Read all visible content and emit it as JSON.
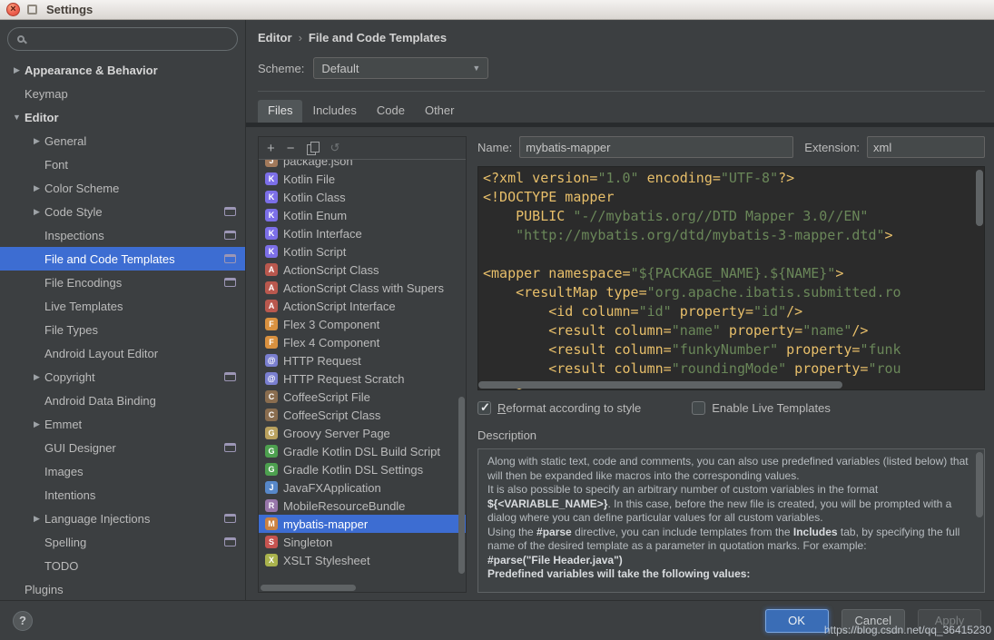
{
  "window": {
    "title": "Settings"
  },
  "colors": {
    "selection_blue": "#3d6dd2",
    "editor_background": "#2b2b2b",
    "xml_tag": "#e8bf6a",
    "xml_string": "#6a8759",
    "panel_background": "#3c3f41"
  },
  "sidebar": {
    "search_placeholder": "",
    "items": [
      {
        "label": "Appearance & Behavior",
        "indent": 0,
        "arrow": "right",
        "bold": true
      },
      {
        "label": "Keymap",
        "indent": 0
      },
      {
        "label": "Editor",
        "indent": 0,
        "arrow": "down",
        "bold": true
      },
      {
        "label": "General",
        "indent": 1,
        "arrow": "right"
      },
      {
        "label": "Font",
        "indent": 1
      },
      {
        "label": "Color Scheme",
        "indent": 1,
        "arrow": "right"
      },
      {
        "label": "Code Style",
        "indent": 1,
        "arrow": "right",
        "badge": true
      },
      {
        "label": "Inspections",
        "indent": 1,
        "badge": true
      },
      {
        "label": "File and Code Templates",
        "indent": 1,
        "badge": true,
        "selected": true
      },
      {
        "label": "File Encodings",
        "indent": 1,
        "badge": true
      },
      {
        "label": "Live Templates",
        "indent": 1
      },
      {
        "label": "File Types",
        "indent": 1
      },
      {
        "label": "Android Layout Editor",
        "indent": 1
      },
      {
        "label": "Copyright",
        "indent": 1,
        "arrow": "right",
        "badge": true
      },
      {
        "label": "Android Data Binding",
        "indent": 1
      },
      {
        "label": "Emmet",
        "indent": 1,
        "arrow": "right"
      },
      {
        "label": "GUI Designer",
        "indent": 1,
        "badge": true
      },
      {
        "label": "Images",
        "indent": 1
      },
      {
        "label": "Intentions",
        "indent": 1
      },
      {
        "label": "Language Injections",
        "indent": 1,
        "arrow": "right",
        "badge": true
      },
      {
        "label": "Spelling",
        "indent": 1,
        "badge": true
      },
      {
        "label": "TODO",
        "indent": 1
      },
      {
        "label": "Plugins",
        "indent": 0
      }
    ]
  },
  "header": {
    "breadcrumb": {
      "first": "Editor",
      "separator": "›",
      "second": "File and Code Templates"
    },
    "scheme_label": "Scheme:",
    "scheme_value": "Default"
  },
  "tabs": [
    {
      "label": "Files",
      "active": true
    },
    {
      "label": "Includes"
    },
    {
      "label": "Code"
    },
    {
      "label": "Other"
    }
  ],
  "templates": {
    "items": [
      {
        "label": "package.json",
        "icon": "json"
      },
      {
        "label": "Kotlin File",
        "icon": "kotlin"
      },
      {
        "label": "Kotlin Class",
        "icon": "kotlin"
      },
      {
        "label": "Kotlin Enum",
        "icon": "kotlin"
      },
      {
        "label": "Kotlin Interface",
        "icon": "kotlin"
      },
      {
        "label": "Kotlin Script",
        "icon": "kotlin"
      },
      {
        "label": "ActionScript Class",
        "icon": "actionscript"
      },
      {
        "label": "ActionScript Class with Supers",
        "icon": "actionscript"
      },
      {
        "label": "ActionScript Interface",
        "icon": "actionscript"
      },
      {
        "label": "Flex 3 Component",
        "icon": "flex"
      },
      {
        "label": "Flex 4 Component",
        "icon": "flex"
      },
      {
        "label": "HTTP Request",
        "icon": "http"
      },
      {
        "label": "HTTP Request Scratch",
        "icon": "http"
      },
      {
        "label": "CoffeeScript File",
        "icon": "coffeescript"
      },
      {
        "label": "CoffeeScript Class",
        "icon": "coffeescript"
      },
      {
        "label": "Groovy Server Page",
        "icon": "groovy"
      },
      {
        "label": "Gradle Kotlin DSL Build Script",
        "icon": "gradle"
      },
      {
        "label": "Gradle Kotlin DSL Settings",
        "icon": "gradle"
      },
      {
        "label": "JavaFXApplication",
        "icon": "javafx"
      },
      {
        "label": "MobileResourceBundle",
        "icon": "resource"
      },
      {
        "label": "mybatis-mapper",
        "icon": "file",
        "selected": true
      },
      {
        "label": "Singleton",
        "icon": "singleton"
      },
      {
        "label": "XSLT Stylesheet",
        "icon": "xslt"
      }
    ],
    "icon_styles": {
      "json": {
        "letter": "J",
        "bg": "#a1795b"
      },
      "kotlin": {
        "letter": "K",
        "bg": "#7c6fe8"
      },
      "actionscript": {
        "letter": "A",
        "bg": "#b9584e"
      },
      "flex": {
        "letter": "F",
        "bg": "#d9913f"
      },
      "http": {
        "letter": "@",
        "bg": "#7a7fd0"
      },
      "coffeescript": {
        "letter": "C",
        "bg": "#8a6d4f"
      },
      "groovy": {
        "letter": "G",
        "bg": "#b9a15e"
      },
      "gradle": {
        "letter": "G",
        "bg": "#4da04f"
      },
      "javafx": {
        "letter": "J",
        "bg": "#5788c9"
      },
      "resource": {
        "letter": "R",
        "bg": "#9876aa"
      },
      "file": {
        "letter": "M",
        "bg": "#cc8242"
      },
      "singleton": {
        "letter": "S",
        "bg": "#c75450"
      },
      "xslt": {
        "letter": "X",
        "bg": "#aab34d"
      }
    }
  },
  "detail": {
    "name_label": "Name:",
    "name_value": "mybatis-mapper",
    "extension_label": "Extension:",
    "extension_value": "xml",
    "reformat_label": "Reformat according to style",
    "reformat_checked": true,
    "live_templates_label": "Enable Live Templates",
    "live_templates_checked": false,
    "description_title": "Description",
    "code_lines": [
      [
        {
          "c": "t",
          "t": "<?xml version="
        },
        {
          "c": "s",
          "t": "\"1.0\""
        },
        {
          "c": "t",
          "t": " encoding="
        },
        {
          "c": "s",
          "t": "\"UTF-8\""
        },
        {
          "c": "t",
          "t": "?>"
        }
      ],
      [
        {
          "c": "t",
          "t": "<!DOCTYPE mapper"
        }
      ],
      [
        {
          "c": "t",
          "t": "    PUBLIC "
        },
        {
          "c": "s",
          "t": "\"-//mybatis.org//DTD Mapper 3.0//EN\""
        }
      ],
      [
        {
          "c": "p",
          "t": "    "
        },
        {
          "c": "s",
          "t": "\"http://mybatis.org/dtd/mybatis-3-mapper.dtd\""
        },
        {
          "c": "t",
          "t": ">"
        }
      ],
      [],
      [
        {
          "c": "t",
          "t": "<mapper namespace="
        },
        {
          "c": "s",
          "t": "\"${PACKAGE_NAME}.${NAME}\""
        },
        {
          "c": "t",
          "t": ">"
        }
      ],
      [
        {
          "c": "t",
          "t": "    <resultMap type="
        },
        {
          "c": "s",
          "t": "\"org.apache.ibatis.submitted.ro"
        }
      ],
      [
        {
          "c": "t",
          "t": "        <id column="
        },
        {
          "c": "s",
          "t": "\"id\""
        },
        {
          "c": "t",
          "t": " property="
        },
        {
          "c": "s",
          "t": "\"id\""
        },
        {
          "c": "t",
          "t": "/>"
        }
      ],
      [
        {
          "c": "t",
          "t": "        <result column="
        },
        {
          "c": "s",
          "t": "\"name\""
        },
        {
          "c": "t",
          "t": " property="
        },
        {
          "c": "s",
          "t": "\"name\""
        },
        {
          "c": "t",
          "t": "/>"
        }
      ],
      [
        {
          "c": "t",
          "t": "        <result column="
        },
        {
          "c": "s",
          "t": "\"funkyNumber\""
        },
        {
          "c": "t",
          "t": " property="
        },
        {
          "c": "s",
          "t": "\"funk"
        }
      ],
      [
        {
          "c": "t",
          "t": "        <result column="
        },
        {
          "c": "s",
          "t": "\"roundingMode\""
        },
        {
          "c": "t",
          "t": " property="
        },
        {
          "c": "s",
          "t": "\"rou"
        }
      ],
      [
        {
          "c": "t",
          "t": "    <"
        }
      ]
    ],
    "description_paragraphs": [
      [
        {
          "t": "Along with static text, code and comments, you can also use predefined variables (listed below) that will then be expanded like macros into the corresponding values."
        }
      ],
      [
        {
          "t": "It is also possible to specify an arbitrary number of custom variables in the format "
        },
        {
          "t": "${<VARIABLE_NAME>}",
          "b": true
        },
        {
          "t": ". In this case, before the new file is created, you will be prompted with a dialog where you can define particular values for all custom variables."
        }
      ],
      [
        {
          "t": "Using the "
        },
        {
          "t": "#parse",
          "b": true
        },
        {
          "t": " directive, you can include templates from the "
        },
        {
          "t": "Includes",
          "b": true
        },
        {
          "t": " tab, by specifying the full name of the desired template as a parameter in quotation marks. For example:"
        }
      ],
      [
        {
          "t": "#parse(\"File Header.java\")",
          "b": true
        }
      ],
      [
        {
          "t": "Predefined variables will take the following values:",
          "b": true
        }
      ]
    ]
  },
  "footer": {
    "help_label": "?",
    "ok_label": "OK",
    "cancel_label": "Cancel",
    "apply_label": "Apply",
    "watermark": "https://blog.csdn.net/qq_36415230"
  }
}
